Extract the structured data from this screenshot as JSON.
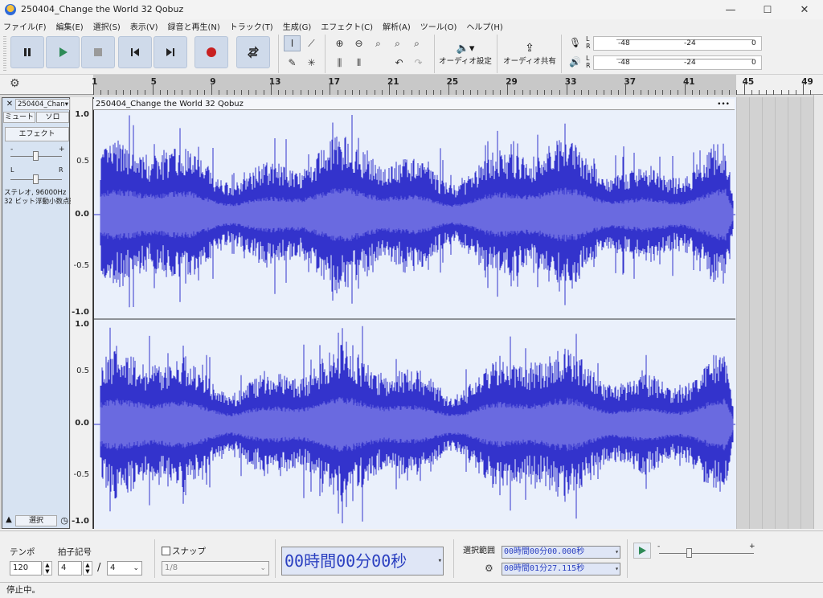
{
  "window": {
    "title": "250404_Change the World 32 Qobuz",
    "minimize": "—",
    "maximize": "☐",
    "close": "✕"
  },
  "menu": [
    "ファイル(F)",
    "編集(E)",
    "選択(S)",
    "表示(V)",
    "録音と再生(N)",
    "トラック(T)",
    "生成(G)",
    "エフェクト(C)",
    "解析(A)",
    "ツール(O)",
    "ヘルプ(H)"
  ],
  "toolbar": {
    "audio_settings": "オーディオ設定",
    "audio_share": "オーディオ共有",
    "meter_record_ticks": [
      "-48",
      "-24",
      "0"
    ],
    "meter_play_ticks": [
      "-48",
      "-24",
      "0"
    ],
    "meter_L": "L",
    "meter_R": "R"
  },
  "ruler": {
    "labels": [
      "1",
      "5",
      "9",
      "13",
      "17",
      "21",
      "25",
      "29",
      "33",
      "37",
      "41",
      "45",
      "49"
    ]
  },
  "track": {
    "name": "250404_Chan",
    "mute": "ミュート",
    "solo": "ソロ",
    "effects": "エフェクト",
    "gain_minus": "-",
    "gain_plus": "+",
    "pan_left": "L",
    "pan_right": "R",
    "info_line1": "ステレオ, 96000Hz",
    "info_line2": "32 ビット浮動小数点数",
    "select": "選択",
    "clip_name": "250404_Change the World 32 Qobuz",
    "clip_menu": "•••"
  },
  "vscale": [
    "1.0",
    "0.5",
    "0.0",
    "-0.5",
    "-1.0"
  ],
  "bottom": {
    "tempo_label": "テンポ",
    "tempo_value": "120",
    "timesig_label": "拍子記号",
    "timesig_num": "4",
    "timesig_slash": "/",
    "timesig_den": "4",
    "snap_label": "スナップ",
    "snap_value": "1/8",
    "time_display": "00時間00分00秒",
    "selection_label": "選択範囲",
    "sel_start": "00時間00分00.000秒",
    "sel_end": "00時間01分27.115秒",
    "play_speed_minus": "-",
    "play_speed_plus": "+"
  },
  "status": "停止中。",
  "colors": {
    "waveform": "#3333cc",
    "waveform_rms": "#6a6ae0",
    "clip_bg": "#eaf0fb",
    "button": "#cfdaea",
    "record": "#c82020",
    "play": "#2e8b57"
  }
}
